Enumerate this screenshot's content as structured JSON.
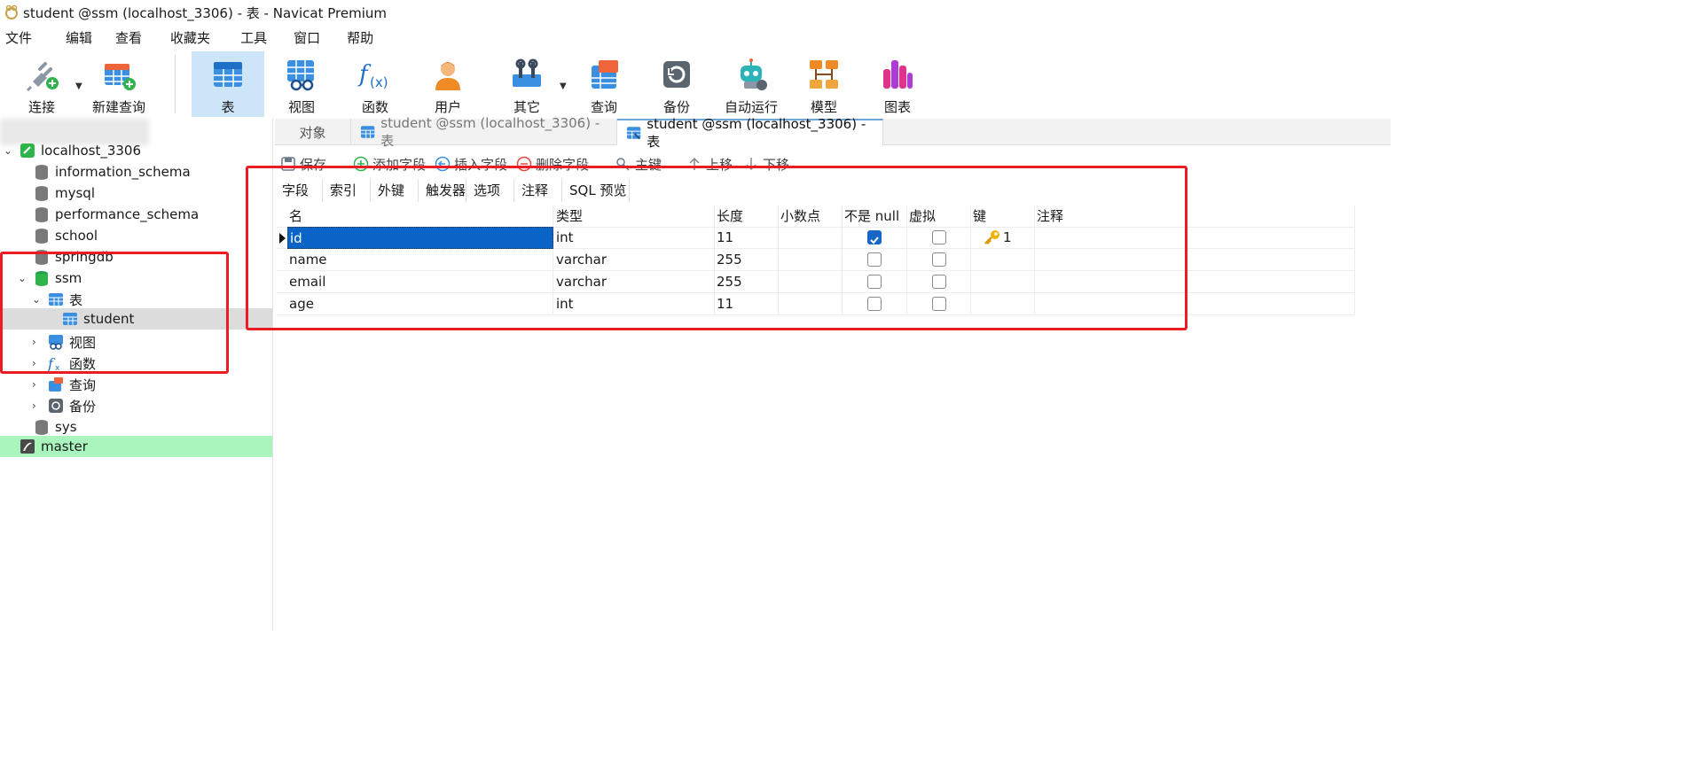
{
  "window": {
    "title": "student @ssm (localhost_3306) - 表 - Navicat Premium"
  },
  "menu": [
    "文件",
    "编辑",
    "查看",
    "收藏夹",
    "工具",
    "窗口",
    "帮助"
  ],
  "toolbar": {
    "buttons": [
      {
        "label": "连接",
        "icon": "plug-icon"
      },
      {
        "label": "新建查询",
        "icon": "new-query-icon"
      },
      {
        "label": "表",
        "icon": "table-icon",
        "active": true
      },
      {
        "label": "视图",
        "icon": "view-icon"
      },
      {
        "label": "函数",
        "icon": "function-icon"
      },
      {
        "label": "用户",
        "icon": "user-icon"
      },
      {
        "label": "其它",
        "icon": "tools-icon"
      },
      {
        "label": "查询",
        "icon": "query-icon"
      },
      {
        "label": "备份",
        "icon": "backup-icon"
      },
      {
        "label": "自动运行",
        "icon": "robot-icon"
      },
      {
        "label": "模型",
        "icon": "model-icon"
      },
      {
        "label": "图表",
        "icon": "chart-icon"
      }
    ]
  },
  "tree": {
    "connection": "localhost_3306",
    "items": [
      {
        "label": "information_schema"
      },
      {
        "label": "mysql"
      },
      {
        "label": "performance_schema"
      },
      {
        "label": "school"
      },
      {
        "label": "springdb"
      },
      {
        "label": "ssm"
      },
      {
        "label": "表"
      },
      {
        "label": "student"
      },
      {
        "label": "视图"
      },
      {
        "label": "函数"
      },
      {
        "label": "查询"
      },
      {
        "label": "备份"
      },
      {
        "label": "sys"
      },
      {
        "label": "master"
      }
    ]
  },
  "tabs": {
    "objects": "对象",
    "tab1": "student @ssm (localhost_3306) - 表",
    "tab2": "student @ssm (localhost_3306) - 表"
  },
  "designer": {
    "actions": [
      "保存",
      "添加字段",
      "插入字段",
      "删除字段",
      "主键",
      "上移",
      "下移"
    ],
    "subtabs": [
      "字段",
      "索引",
      "外键",
      "触发器",
      "选项",
      "注释",
      "SQL 预览"
    ],
    "columns": [
      "名",
      "类型",
      "长度",
      "小数点",
      "不是 null",
      "虚拟",
      "键",
      "注释"
    ],
    "rows": [
      {
        "name": "id",
        "type": "int",
        "length": "11",
        "decimals": "",
        "not_null": true,
        "virtual": false,
        "key": "1"
      },
      {
        "name": "name",
        "type": "varchar",
        "length": "255",
        "decimals": "",
        "not_null": false,
        "virtual": false,
        "key": ""
      },
      {
        "name": "email",
        "type": "varchar",
        "length": "255",
        "decimals": "",
        "not_null": false,
        "virtual": false,
        "key": ""
      },
      {
        "name": "age",
        "type": "int",
        "length": "11",
        "decimals": "",
        "not_null": false,
        "virtual": false,
        "key": ""
      }
    ]
  },
  "colors": {
    "accent": "#1667c5",
    "active_toolbar": "#cde6f7",
    "master_row": "#a9f5bd",
    "highlight_box": "#ec1c24"
  }
}
